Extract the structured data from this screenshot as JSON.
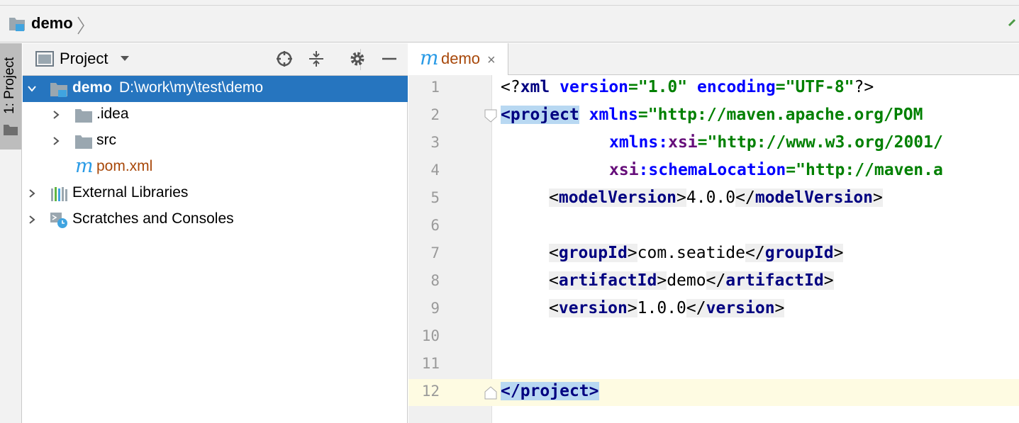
{
  "navbar": {
    "title": "demo"
  },
  "sidebar_tab": {
    "label": "1: Project"
  },
  "project_panel": {
    "title": "Project",
    "tree": [
      {
        "name": "demo",
        "path": "D:\\work\\my\\test\\demo",
        "expanded": true,
        "selected": true
      },
      {
        "name": ".idea",
        "expanded": false
      },
      {
        "name": "src",
        "expanded": false
      },
      {
        "name": "pom.xml"
      },
      {
        "name": "External Libraries",
        "expanded": false
      },
      {
        "name": "Scratches and Consoles",
        "expanded": false
      }
    ]
  },
  "editor": {
    "tab": {
      "icon_letter": "m",
      "label": "demo",
      "close": "×"
    },
    "line_numbers": [
      "1",
      "2",
      "3",
      "4",
      "5",
      "6",
      "7",
      "8",
      "9",
      "10",
      "11",
      "12"
    ],
    "current_line": 12,
    "code": {
      "l1_open": "<?",
      "l1_tag": "xml",
      "l1_a1": " version",
      "l1_v1": "=\"1.0\"",
      "l1_a2": " encoding",
      "l1_v2": "=\"UTF-8\"",
      "l1_close": "?>",
      "l2_open": "<",
      "l2_tag": "project",
      "l2_a1": "xmlns",
      "l2_v1": "=\"http://maven.apache.org/POM",
      "l3_ns": "xmlns",
      "l3_colon": ":",
      "l3_a": "xsi",
      "l3_v": "=\"http://www.w3.org/2001/",
      "l4_ns": "xsi",
      "l4_colon": ":",
      "l4_a": "schemaLocation",
      "l4_v": "=\"http://maven.a",
      "l5_tag": "modelVersion",
      "l5_val": "4.0.0",
      "l7_tag": "groupId",
      "l7_val": "com.seatide",
      "l8_tag": "artifactId",
      "l8_val": "demo",
      "l9_tag": "version",
      "l9_val": "1.0.0",
      "l12_tag": "project"
    }
  },
  "colors": {
    "selection": "#2675bf",
    "maven_file": "#a8480a",
    "tag": "#000080",
    "string": "#008000",
    "namespace": "#660e7a",
    "current_line": "#fefbe2"
  }
}
